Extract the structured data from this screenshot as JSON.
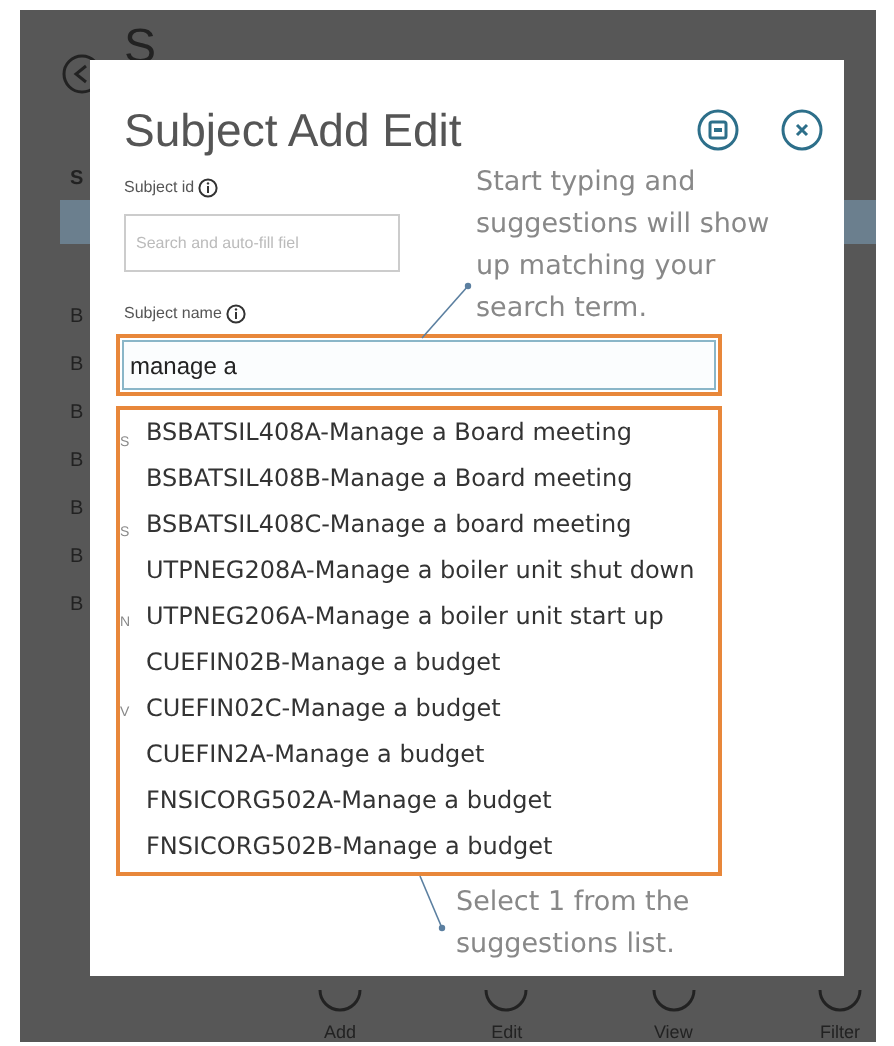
{
  "background": {
    "title_fragment": "S",
    "header_fragment": "S",
    "row_fragments": [
      "B",
      "B",
      "B",
      "B",
      "B",
      "B",
      "B"
    ],
    "toolbar": [
      "Add",
      "Edit",
      "View",
      "Filter"
    ]
  },
  "modal": {
    "title": "Subject Add Edit",
    "subject_id": {
      "label": "Subject id",
      "placeholder": "Search and auto-fill fiel"
    },
    "subject_name": {
      "label": "Subject name",
      "value": "manage a"
    },
    "hidden_label_fragments": [
      "S",
      "S",
      "N",
      "V"
    ],
    "suggestions": [
      {
        "text": "BSBATSIL408A-Manage a Board meeting"
      },
      {
        "text": "BSBATSIL408B-Manage a Board meeting"
      },
      {
        "text": "BSBATSIL408C-Manage a board meeting"
      },
      {
        "text": "UTPNEG208A-Manage a boiler unit shut down"
      },
      {
        "text": "UTPNEG206A-Manage a boiler unit start up"
      },
      {
        "text": "CUEFIN02B-Manage a budget"
      },
      {
        "text": "CUEFIN02C-Manage a budget"
      },
      {
        "text": "CUEFIN2A-Manage a budget"
      },
      {
        "text": "FNSICORG502A-Manage a budget"
      },
      {
        "text": "FNSICORG502B-Manage a budget"
      }
    ]
  },
  "annotations": [
    {
      "text": "Start typing and suggestions will show up matching your search term."
    },
    {
      "text": "Select 1 from the suggestions list."
    }
  ]
}
